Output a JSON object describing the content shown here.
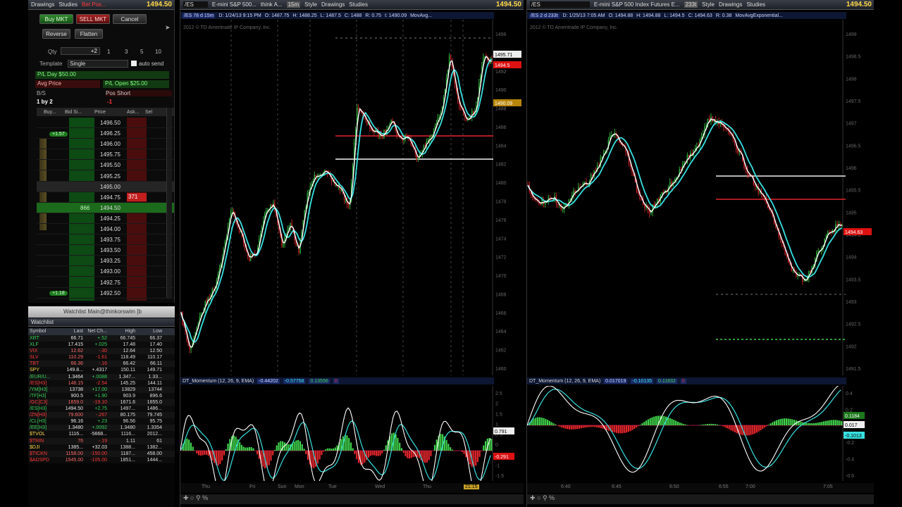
{
  "left_toolbar": {
    "drawings": "Drawings",
    "studies": "Studies",
    "ticker": "Bet Pos...",
    "price": "1494.50"
  },
  "order": {
    "buy_mkt": "Buy MKT",
    "sell_mkt": "SELL MKT",
    "cancel": "Cancel",
    "reverse": "Reverse",
    "flatten": "Flatten",
    "qty_label": "Qty",
    "qty": "+2",
    "qty_presets": [
      "1",
      "3",
      "5",
      "10"
    ],
    "template_label": "Template",
    "template": "Single",
    "auto_send": "auto send",
    "pl_day": "P/L Day $50.00",
    "avg_price": "Avg Price",
    "pl_open": "P/L Open $25.00",
    "bs": "B/S",
    "pos_label": "Pos Short",
    "pos_value": "-1",
    "bs_value": "1 by 2"
  },
  "ladder": {
    "headers": [
      "Buy...",
      "Bid Si...",
      "Price",
      "Ask...",
      "Sel"
    ],
    "prices": [
      "1496.50",
      "1496.25",
      "1496.00",
      "1495.75",
      "1495.50",
      "1495.25",
      "1495.00",
      "1494.75",
      "1494.50",
      "1494.25",
      "1494.00",
      "1493.75",
      "1493.50",
      "1493.25",
      "1493.00",
      "1492.75",
      "1492.50"
    ],
    "bid_866": "866",
    "ask_371": "371",
    "order_tag_top": "+1.57",
    "order_tag_bottom": "+1.18"
  },
  "watchlist": {
    "title": "Watchlist Main@thinkorswim [b",
    "tab": "Watchlist",
    "headers": [
      "Symbol",
      "Last",
      "Net Ch...",
      "High",
      "Low"
    ],
    "rows": [
      [
        "XRT",
        "66.71",
        "+.52",
        "66.745",
        "66.37",
        "g"
      ],
      [
        "XLF",
        "17.415",
        "+.025",
        "17.48",
        "17.40",
        "g"
      ],
      [
        "VIX",
        "12.62",
        "-.30",
        "12.64",
        "12.50",
        "r"
      ],
      [
        "SLV",
        "110.29",
        "-1.61",
        "118.49",
        "110.17",
        "r"
      ],
      [
        "TBT",
        "66.36",
        "-.16",
        "66.42",
        "66.11",
        "r"
      ],
      [
        "SPY",
        "149.8...",
        "+.4317",
        "150.11",
        "149.71",
        "w"
      ],
      [
        "/EUR/U...",
        "1.3464",
        "+.0088",
        "1.347...",
        "1.33...",
        "g"
      ],
      [
        "/ES[H3]",
        "148.15",
        "-2.54",
        "145.25",
        "144.11",
        "r"
      ],
      [
        "/YM[H3]",
        "13738",
        "+17.00",
        "13829",
        "13744",
        "g"
      ],
      [
        "/TF[H3]",
        "900.5",
        "+1.90",
        "903.9",
        "896.6",
        "g"
      ],
      [
        "/GC[C3]",
        "1659.0",
        "-19.10",
        "1671.6",
        "1655.0",
        "r"
      ],
      [
        "/ES[H3]",
        "1494.50",
        "+2.75",
        "1497...",
        "1486...",
        "g"
      ],
      [
        "/ZN[H3]",
        "79.600",
        "-.267",
        "80.175",
        "79.745",
        "r"
      ],
      [
        "/CL[H3]",
        "96.16",
        "+.23",
        "96.56",
        "95.75",
        "g"
      ],
      [
        "/EE[H3]",
        "1.3480",
        "+.0092",
        "1.3480",
        "1.3354",
        "g"
      ],
      [
        "$TVOL",
        "1116...",
        "-5668...",
        "1116...",
        "2012...",
        "w"
      ],
      [
        "$TRIN",
        "76",
        "-.19",
        "1.11",
        "61",
        "r"
      ],
      [
        "$DJI",
        "1385...",
        "+32.03",
        "1388...",
        "1382...",
        "w"
      ],
      [
        "$TICKN",
        "1158.00",
        "-150.00",
        "1187...",
        "458.00",
        "r"
      ],
      [
        "$ADSPD",
        "1545.00",
        "-105.00",
        "1851...",
        "1444...",
        "r"
      ]
    ]
  },
  "chart1": {
    "symbol": "/ES",
    "agg": "15m",
    "style": "Style",
    "drawings": "Drawings",
    "studies": "Studies",
    "price": "1494.50",
    "toolbar_tab": "E-mini S&P 500...",
    "think": "think A...",
    "info": [
      "/ES 78 d 15m",
      "D: 1/24/13 9:15 PM",
      "O: 1487.75",
      "H: 1488.25",
      "L: 1487.5",
      "C: 1488",
      "R: 0.75",
      "I: 1490.09",
      "MovAvg..."
    ],
    "copyright": "2012 © TD Ameritrade IP Company, Inc.",
    "yaxis": [
      "1496",
      "1494",
      "1492",
      "1490",
      "1488",
      "1486",
      "1484",
      "1482",
      "1480",
      "1478",
      "1476",
      "1474",
      "1472",
      "1470",
      "1468",
      "1466",
      "1464",
      "1462",
      "1460"
    ],
    "tags": {
      "t1": "1495.71",
      "t2": "1494.5",
      "t3": "1490.09"
    },
    "xaxis": [
      "Thu",
      "Fri",
      "Sun",
      "Mon",
      "Tue",
      "Wed",
      "Thu",
      "21:15"
    ],
    "study": "DT_Momentum (12, 26, 9, EMA)",
    "study_vals": [
      "-0.44202",
      "-0.57758",
      "0.13556",
      "0"
    ],
    "study_axis": [
      "2.5",
      "2",
      "1.5",
      "1",
      "0.5",
      "0",
      "-0.5",
      "-1",
      "-1.5"
    ],
    "study_tags": [
      "0.791",
      "-0.291"
    ]
  },
  "chart2": {
    "symbol": "/ES",
    "agg": "233t",
    "style": "Style",
    "drawings": "Drawings",
    "studies": "Studies",
    "price": "1494.50",
    "toolbar_tab": "E-mini S&P 500 Index Futures E...",
    "info": [
      "/ES 2 d 233t",
      "D: 1/25/13 7:05 AM",
      "O: 1494.88",
      "H: 1494.88",
      "L: 1494.5",
      "C: 1494.63",
      "R: 0.38",
      "MovAvgExponential..."
    ],
    "copyright": "2012 © TD Ameritrade IP Company, Inc.",
    "yaxis": [
      "1499",
      "1498.5",
      "1498",
      "1497.5",
      "1497",
      "1496.5",
      "1496",
      "1495.5",
      "1495",
      "1494.5",
      "1494",
      "1493.5",
      "1493",
      "1492.5",
      "1492",
      "1491.5"
    ],
    "tag": "1494.63",
    "xaxis": [
      "6:40",
      "6:45",
      "6:50",
      "6:55",
      "7:00",
      "7:05"
    ],
    "study": "DT_Momentum (12, 26, 9, EMA)",
    "study_vals": [
      "0.017019",
      "-0.10135",
      "0.11832",
      "0"
    ],
    "study_axis": [
      "0.4",
      "0.2",
      "0",
      "-0.2",
      "-0.4",
      "-0.6"
    ],
    "study_tags": [
      "0.1184",
      "0.017",
      "-0.1013"
    ]
  },
  "colors": {
    "up": "#3fd14a",
    "down": "#e3262c",
    "ma_fast": "#ffffff",
    "ma_slow": "#38e0e0",
    "price_tag": "#ffd84a"
  }
}
